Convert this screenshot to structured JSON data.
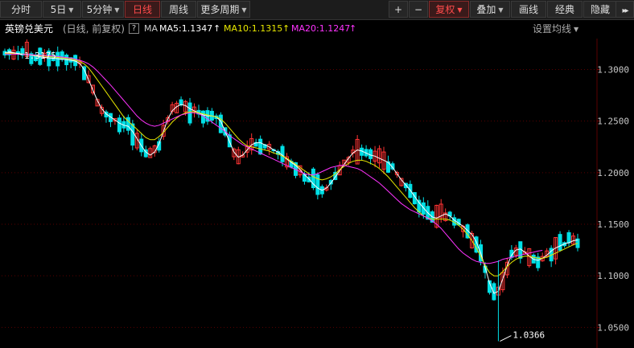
{
  "toolbar": {
    "left_buttons": [
      {
        "label": "分时",
        "active": false,
        "dropdown": false
      },
      {
        "label": "5日",
        "active": false,
        "dropdown": true
      },
      {
        "label": "5分钟",
        "active": false,
        "dropdown": true
      },
      {
        "label": "日线",
        "active": true,
        "dropdown": false
      },
      {
        "label": "周线",
        "active": false,
        "dropdown": false
      },
      {
        "label": "更多周期",
        "active": false,
        "dropdown": true
      }
    ],
    "right_buttons": [
      {
        "label": "+",
        "active": false,
        "dropdown": false
      },
      {
        "label": "−",
        "active": false,
        "dropdown": false
      },
      {
        "label": "复权",
        "active": true,
        "dropdown": true
      },
      {
        "label": "叠加",
        "active": false,
        "dropdown": true
      },
      {
        "label": "画线",
        "active": false,
        "dropdown": false
      },
      {
        "label": "经典",
        "active": false,
        "dropdown": false
      },
      {
        "label": "隐藏",
        "active": false,
        "dropdown": false
      }
    ],
    "collapse_icon": "double-chevron-right-icon"
  },
  "legend": {
    "title": "英镑兑美元",
    "mode": "(日线, 前复权)",
    "help": "?",
    "ma_label": "MA",
    "ma5": "MA5:1.1347",
    "ma10": "MA10:1.1315",
    "ma20": "MA20:1.1247",
    "settings": "设置均线",
    "arrow_icon": "up-arrow-icon"
  },
  "colors": {
    "up": "#ff3333",
    "down": "#00e0e6",
    "ma5": "#ffffff",
    "ma10": "#e8e800",
    "ma20": "#ff33ff",
    "grid": "#5a0000",
    "axis_text": "#c8c8c8",
    "annotation": "#ffffff"
  },
  "chart_data": {
    "type": "candlestick",
    "ylim": [
      1.03,
      1.33
    ],
    "y_ticks": [
      "1.3000",
      "1.2500",
      "1.2000",
      "1.1500",
      "1.1000",
      "1.0500"
    ],
    "annotations": [
      {
        "text": "1.3175",
        "kind": "high"
      },
      {
        "text": "1.0366",
        "kind": "low"
      }
    ],
    "series": [
      {
        "name": "MA5",
        "values": [
          1.3165,
          1.3163,
          1.316,
          1.3155,
          1.315,
          1.3146,
          1.3138,
          1.313,
          1.3122,
          1.3118,
          1.3112,
          1.3108,
          1.3105,
          1.31,
          1.3095,
          1.309,
          1.3082,
          1.306,
          1.3,
          1.29,
          1.28,
          1.27,
          1.262,
          1.257,
          1.254,
          1.251,
          1.248,
          1.246,
          1.245,
          1.24,
          1.233,
          1.226,
          1.22,
          1.217,
          1.22,
          1.228,
          1.24,
          1.252,
          1.26,
          1.264,
          1.266,
          1.265,
          1.262,
          1.26,
          1.258,
          1.256,
          1.255,
          1.255,
          1.254,
          1.25,
          1.24,
          1.23,
          1.22,
          1.215,
          1.217,
          1.222,
          1.227,
          1.229,
          1.229,
          1.227,
          1.225,
          1.222,
          1.22,
          1.217,
          1.213,
          1.21,
          1.207,
          1.203,
          1.198,
          1.194,
          1.189,
          1.185,
          1.183,
          1.185,
          1.19,
          1.196,
          1.202,
          1.208,
          1.214,
          1.219,
          1.222,
          1.221,
          1.219,
          1.217,
          1.216,
          1.214,
          1.212,
          1.21,
          1.205,
          1.199,
          1.193,
          1.188,
          1.183,
          1.177,
          1.171,
          1.166,
          1.161,
          1.157,
          1.156,
          1.158,
          1.16,
          1.158,
          1.154,
          1.151,
          1.148,
          1.144,
          1.14,
          1.133,
          1.122,
          1.108,
          1.093,
          1.083,
          1.085,
          1.097,
          1.11,
          1.12,
          1.125,
          1.126,
          1.123,
          1.119,
          1.116,
          1.115,
          1.117,
          1.12,
          1.124,
          1.127,
          1.129,
          1.131,
          1.132,
          1.134,
          1.1347
        ]
      },
      {
        "name": "MA10",
        "values": [
          1.3158,
          1.3157,
          1.3155,
          1.3152,
          1.3149,
          1.3146,
          1.3142,
          1.3137,
          1.3133,
          1.3129,
          1.3125,
          1.3121,
          1.3117,
          1.3112,
          1.3107,
          1.3101,
          1.3092,
          1.3078,
          1.3055,
          1.3015,
          1.296,
          1.29,
          1.284,
          1.278,
          1.272,
          1.266,
          1.26,
          1.254,
          1.25,
          1.246,
          1.242,
          1.238,
          1.234,
          1.232,
          1.232,
          1.235,
          1.239,
          1.244,
          1.249,
          1.253,
          1.256,
          1.258,
          1.259,
          1.259,
          1.258,
          1.257,
          1.256,
          1.255,
          1.254,
          1.252,
          1.248,
          1.243,
          1.238,
          1.233,
          1.229,
          1.226,
          1.225,
          1.224,
          1.223,
          1.222,
          1.221,
          1.219,
          1.218,
          1.216,
          1.214,
          1.211,
          1.208,
          1.205,
          1.202,
          1.199,
          1.196,
          1.194,
          1.193,
          1.194,
          1.196,
          1.199,
          1.203,
          1.206,
          1.209,
          1.211,
          1.212,
          1.212,
          1.211,
          1.209,
          1.207,
          1.204,
          1.2,
          1.196,
          1.191,
          1.186,
          1.181,
          1.176,
          1.171,
          1.166,
          1.162,
          1.158,
          1.156,
          1.155,
          1.155,
          1.155,
          1.155,
          1.154,
          1.152,
          1.149,
          1.145,
          1.14,
          1.134,
          1.127,
          1.119,
          1.11,
          1.103,
          1.1,
          1.1,
          1.104,
          1.109,
          1.113,
          1.116,
          1.118,
          1.119,
          1.119,
          1.118,
          1.117,
          1.117,
          1.118,
          1.12,
          1.122,
          1.124,
          1.126,
          1.128,
          1.13,
          1.1315
        ]
      },
      {
        "name": "MA20",
        "values": [
          1.315,
          1.315,
          1.3149,
          1.3148,
          1.3147,
          1.3145,
          1.3143,
          1.3141,
          1.3139,
          1.3136,
          1.3133,
          1.313,
          1.3126,
          1.3121,
          1.3116,
          1.311,
          1.3101,
          1.309,
          1.3075,
          1.3055,
          1.3025,
          1.2985,
          1.294,
          1.2895,
          1.285,
          1.28,
          1.275,
          1.27,
          1.265,
          1.26,
          1.255,
          1.251,
          1.248,
          1.246,
          1.245,
          1.246,
          1.248,
          1.25,
          1.252,
          1.254,
          1.256,
          1.257,
          1.258,
          1.258,
          1.257,
          1.255,
          1.252,
          1.249,
          1.246,
          1.243,
          1.24,
          1.236,
          1.233,
          1.23,
          1.227,
          1.225,
          1.223,
          1.221,
          1.219,
          1.217,
          1.215,
          1.213,
          1.211,
          1.209,
          1.207,
          1.205,
          1.203,
          1.201,
          1.199,
          1.198,
          1.198,
          1.199,
          1.201,
          1.203,
          1.205,
          1.206,
          1.207,
          1.207,
          1.206,
          1.205,
          1.204,
          1.202,
          1.199,
          1.196,
          1.193,
          1.19,
          1.186,
          1.182,
          1.178,
          1.174,
          1.17,
          1.167,
          1.164,
          1.162,
          1.16,
          1.158,
          1.156,
          1.153,
          1.15,
          1.146,
          1.141,
          1.136,
          1.131,
          1.126,
          1.122,
          1.119,
          1.116,
          1.114,
          1.113,
          1.112,
          1.112,
          1.113,
          1.114,
          1.116,
          1.117,
          1.118,
          1.119,
          1.12,
          1.121,
          1.122,
          1.123,
          1.124,
          1.1247
        ]
      }
    ]
  }
}
